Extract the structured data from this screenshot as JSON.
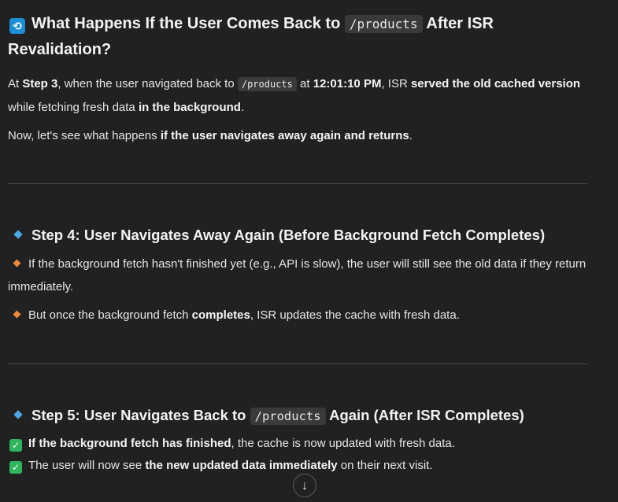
{
  "section1": {
    "icon": "refresh-icon",
    "icon_glyph": "🔄",
    "title_a": "What Happens If the User Comes Back to",
    "title_code": "/products",
    "title_b": "After ISR Revalidation?",
    "p1": {
      "t1": "At ",
      "b1": "Step 3",
      "t2": ", when the user navigated back to ",
      "code": "/products",
      "t3": " at ",
      "b2": "12:01:10 PM",
      "t4": ", ISR ",
      "b3": "served the old cached version",
      "t5": " while fetching fresh data ",
      "b4": "in the background",
      "t6": "."
    },
    "p2": {
      "t1": "Now, let's see what happens ",
      "b1": "if the user navigates away again and returns",
      "t2": "."
    }
  },
  "step4": {
    "title": "Step 4: User Navigates Away Again (Before Background Fetch Completes)",
    "bullet1": "If the background fetch hasn't finished yet (e.g., API is slow), the user will still see the old data if they return immediately.",
    "bullet2": {
      "t1": "But once the background fetch ",
      "b1": "completes",
      "t2": ", ISR updates the cache with fresh data."
    }
  },
  "step5": {
    "title_a": "Step 5: User Navigates Back to",
    "title_code": "/products",
    "title_b": "Again (After ISR Completes)",
    "check1": {
      "b1": "If the background fetch has finished",
      "t1": ", the cache is now updated with fresh data."
    },
    "check2": {
      "t1": "The user will now see ",
      "b1": "the new updated data immediately",
      "t2": " on their next visit."
    }
  },
  "scroll_button": {
    "icon": "arrow-down-icon",
    "glyph": "↓"
  }
}
